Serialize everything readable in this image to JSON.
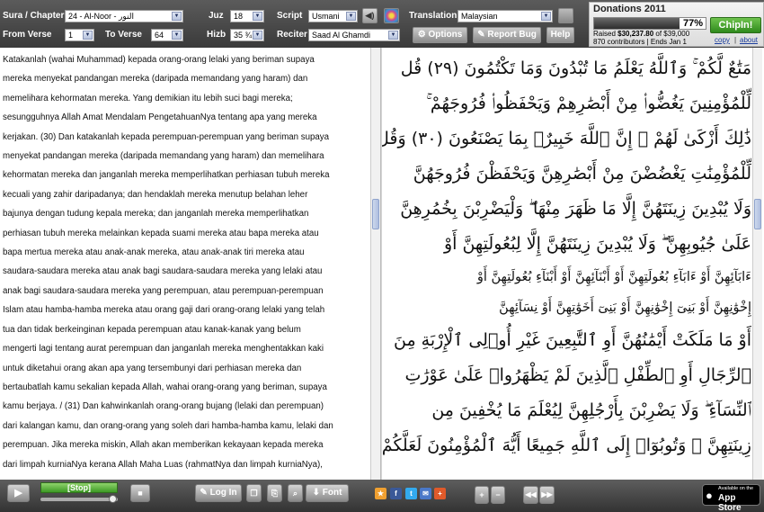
{
  "topbar": {
    "sura_label": "Sura / Chapter",
    "sura_value": "24 - Al-Noor - النور",
    "juz_label": "Juz",
    "juz_value": "18",
    "script_label": "Script",
    "script_value": "Usmani",
    "translation_label": "Translation",
    "translation_value": "Malaysian",
    "from_label": "From Verse",
    "from_value": "1",
    "to_label": "To Verse",
    "to_value": "64",
    "hizb_label": "Hizb",
    "hizb_value": "35 ¾",
    "reciter_label": "Reciter",
    "reciter_value": "Saad Al Ghamdi",
    "options_label": "Options",
    "report_label": "Report Bug",
    "help_label": "Help"
  },
  "donation": {
    "title": "Donations 2011",
    "percent": "77%",
    "progress": 0.77,
    "raised_prefix": "Raised ",
    "raised_amount": "$30,237.80",
    "raised_suffix": " of $39,000",
    "contributors": "870 contributors | Ends Jan 1",
    "chipin_label": "ChipIn!",
    "copy_label": "copy",
    "about_label": "about"
  },
  "translation_lines": [
    "Katakanlah (wahai Muhammad) kepada orang-orang lelaki yang beriman supaya",
    "mereka menyekat pandangan mereka (daripada memandang yang haram) dan",
    "memelihara kehormatan mereka. Yang demikian itu lebih suci bagi mereka;",
    "sesungguhnya Allah Amat Mendalam PengetahuanNya tentang apa yang mereka",
    "kerjakan. (30) Dan katakanlah kepada perempuan-perempuan yang beriman supaya",
    "menyekat pandangan mereka (daripada memandang yang haram) dan memelihara",
    "kehormatan mereka dan janganlah mereka memperlihatkan perhiasan tubuh mereka",
    "kecuali yang zahir daripadanya; dan hendaklah mereka menutup belahan leher",
    "bajunya dengan tudung kepala mereka; dan janganlah mereka memperlihatkan",
    "perhiasan tubuh mereka melainkan kepada suami mereka atau bapa mereka atau",
    "bapa mertua mereka atau anak-anak mereka, atau anak-anak tiri mereka atau",
    "saudara-saudara mereka atau anak bagi saudara-saudara mereka yang lelaki atau",
    "anak bagi saudara-saudara mereka yang perempuan, atau perempuan-perempuan",
    "Islam atau hamba-hamba mereka atau orang gaji dari orang-orang lelaki yang telah",
    "tua dan tidak berkeinginan kepada perempuan atau kanak-kanak yang belum",
    "mengerti lagi tentang aurat perempuan dan janganlah mereka menghentakkan kaki",
    "untuk diketahui orang akan apa yang tersembunyi dari perhiasan mereka dan",
    "bertaubatlah kamu sekalian kepada Allah, wahai orang-orang yang beriman, supaya",
    "kamu berjaya. / (31) Dan kahwinkanlah orang-orang bujang (lelaki dan perempuan)",
    "dari kalangan kamu, dan orang-orang yang soleh dari hamba-hamba kamu, lelaki dan",
    "perempuan. Jika mereka miskin, Allah akan memberikan kekayaan kepada mereka",
    "dari limpah kurniaNya kerana Allah Maha Luas (rahmatNya dan limpah kurniaNya),"
  ],
  "arabic_lines": [
    "مَتَٰعٌ لَّكُمْ ۚ وَٱللَّهُ يَعْلَمُ مَا تُبْدُونَ وَمَا تَكْتُمُونَ (٢٩) قُل",
    "لِّلْمُؤْمِنِينَ يَغُضُّوا۟ مِنْ أَبْصَٰرِهِمْ وَيَحْفَظُوا۟ فُرُوجَهُمْ ۚ",
    "ذَٰلِكَ أَزْكَىٰ لَهُمْ ۗ إِنَّ ٱللَّهَ خَبِيرٌۢ بِمَا يَصْنَعُونَ (٣٠) وَقُل",
    "لِّلْمُؤْمِنَٰتِ يَغْضُضْنَ مِنْ أَبْصَٰرِهِنَّ وَيَحْفَظْنَ فُرُوجَهُنَّ",
    "وَلَا يُبْدِينَ زِينَتَهُنَّ إِلَّا مَا ظَهَرَ مِنْهَا ۖ وَلْيَضْرِبْنَ بِخُمُرِهِنَّ",
    "عَلَىٰ جُيُوبِهِنَّ ۖ وَلَا يُبْدِينَ زِينَتَهُنَّ إِلَّا لِبُعُولَتِهِنَّ أَوْ",
    "ءَابَآئِهِنَّ أَوْ ءَابَآءِ بُعُولَتِهِنَّ أَوْ أَبْنَآئِهِنَّ أَوْ أَبْنَآءِ بُعُولَتِهِنَّ أَوْ",
    "إِخْوَٰنِهِنَّ أَوْ بَنِىٓ إِخْوَٰنِهِنَّ أَوْ بَنِىٓ أَخَوَٰتِهِنَّ أَوْ نِسَآئِهِنَّ",
    "أَوْ مَا مَلَكَتْ أَيْمَٰنُهُنَّ أَوِ ٱلتَّٰبِعِينَ غَيْرِ أُو۟لِى ٱلْإِرْبَةِ مِنَ",
    "ٱلرِّجَالِ أَوِ ٱلطِّفْلِ ٱلَّذِينَ لَمْ يَظْهَرُوا۟ عَلَىٰ عَوْرَٰتِ",
    "ٱلنِّسَآءِ ۖ وَلَا يَضْرِبْنَ بِأَرْجُلِهِنَّ لِيُعْلَمَ مَا يُخْفِينَ مِن",
    "زِينَتِهِنَّ ۚ وَتُوبُوٓا۟ إِلَى ٱللَّهِ جَمِيعًا أَيُّهَ ٱلْمُؤْمِنُونَ لَعَلَّكُمْ"
  ],
  "bottombar": {
    "status_label": "[Stop]",
    "login_label": "Log In",
    "font_label": "Font",
    "appstore_small": "Available on the",
    "appstore_label": "App Store"
  }
}
